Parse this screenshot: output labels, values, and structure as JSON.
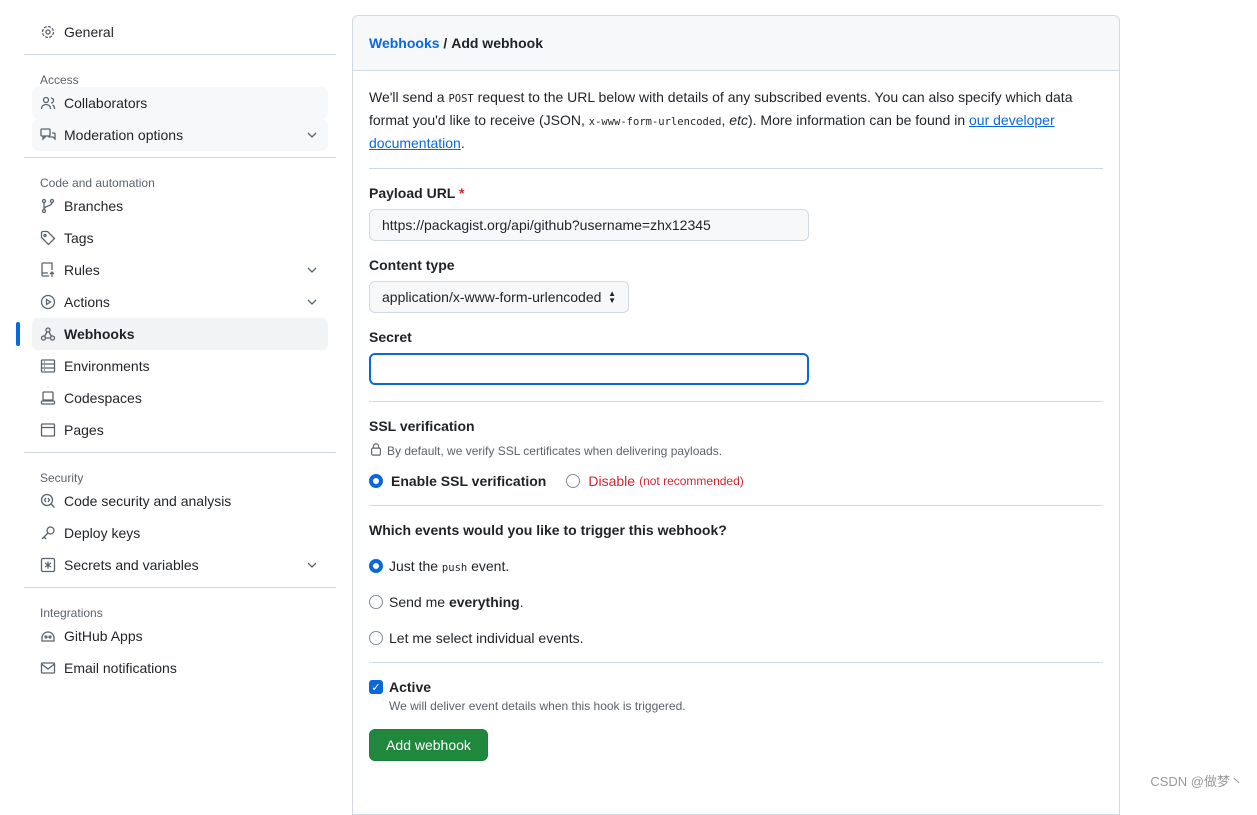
{
  "sidebar": {
    "general": "General",
    "sections": [
      {
        "title": "Access",
        "items": [
          {
            "label": "Collaborators",
            "icon": "people-icon"
          },
          {
            "label": "Moderation options",
            "icon": "comment-discussion-icon"
          }
        ]
      },
      {
        "title": "Code and automation",
        "items": [
          {
            "label": "Branches",
            "icon": "git-branch-icon"
          },
          {
            "label": "Tags",
            "icon": "tag-icon"
          },
          {
            "label": "Rules",
            "icon": "repo-push-icon"
          },
          {
            "label": "Actions",
            "icon": "play-icon"
          },
          {
            "label": "Webhooks",
            "icon": "webhook-icon",
            "selected": true
          },
          {
            "label": "Environments",
            "icon": "server-icon"
          },
          {
            "label": "Codespaces",
            "icon": "codespaces-icon"
          },
          {
            "label": "Pages",
            "icon": "browser-icon"
          }
        ]
      },
      {
        "title": "Security",
        "items": [
          {
            "label": "Code security and analysis",
            "icon": "codescan-icon"
          },
          {
            "label": "Deploy keys",
            "icon": "key-icon"
          },
          {
            "label": "Secrets and variables",
            "icon": "key-asterisk-icon"
          }
        ]
      },
      {
        "title": "Integrations",
        "items": [
          {
            "label": "GitHub Apps",
            "icon": "apps-icon"
          },
          {
            "label": "Email notifications",
            "icon": "mail-icon"
          }
        ]
      }
    ]
  },
  "header": {
    "breadcrumb_link": "Webhooks",
    "separator": " / ",
    "title": "Add webhook"
  },
  "intro": {
    "t1": "We'll send a ",
    "post": "POST",
    "t2": " request to the URL below with details of any subscribed events. You can also specify which data format you'd like to receive (JSON, ",
    "enc": "x-www-form-urlencoded",
    "t3": ", ",
    "etc": "etc",
    "t4": "). More information can be found in ",
    "link": "our developer documentation",
    "t5": "."
  },
  "payload": {
    "label": "Payload URL",
    "required": "*",
    "value": "https://packagist.org/api/github?username=zhx12345"
  },
  "content_type": {
    "label": "Content type",
    "value": "application/x-www-form-urlencoded"
  },
  "secret": {
    "label": "Secret",
    "value": ""
  },
  "ssl": {
    "label": "SSL verification",
    "note": "By default, we verify SSL certificates when delivering payloads.",
    "enable": "Enable SSL verification",
    "disable": "Disable",
    "disable_note": "(not recommended)",
    "selected": "enable"
  },
  "events": {
    "label": "Which events would you like to trigger this webhook?",
    "o1a": "Just the ",
    "o1code": "push",
    "o1b": " event.",
    "o2a": "Send me ",
    "o2b": "everything",
    "o2c": ".",
    "o3": "Let me select individual events.",
    "selected": 0
  },
  "active": {
    "label": "Active",
    "checked": true,
    "note": "We will deliver event details when this hook is triggered."
  },
  "submit": "Add webhook",
  "watermark": "CSDN @做梦丶",
  "colors": {
    "accent": "#0969da",
    "button": "#1f883d",
    "danger": "#d1242f"
  }
}
